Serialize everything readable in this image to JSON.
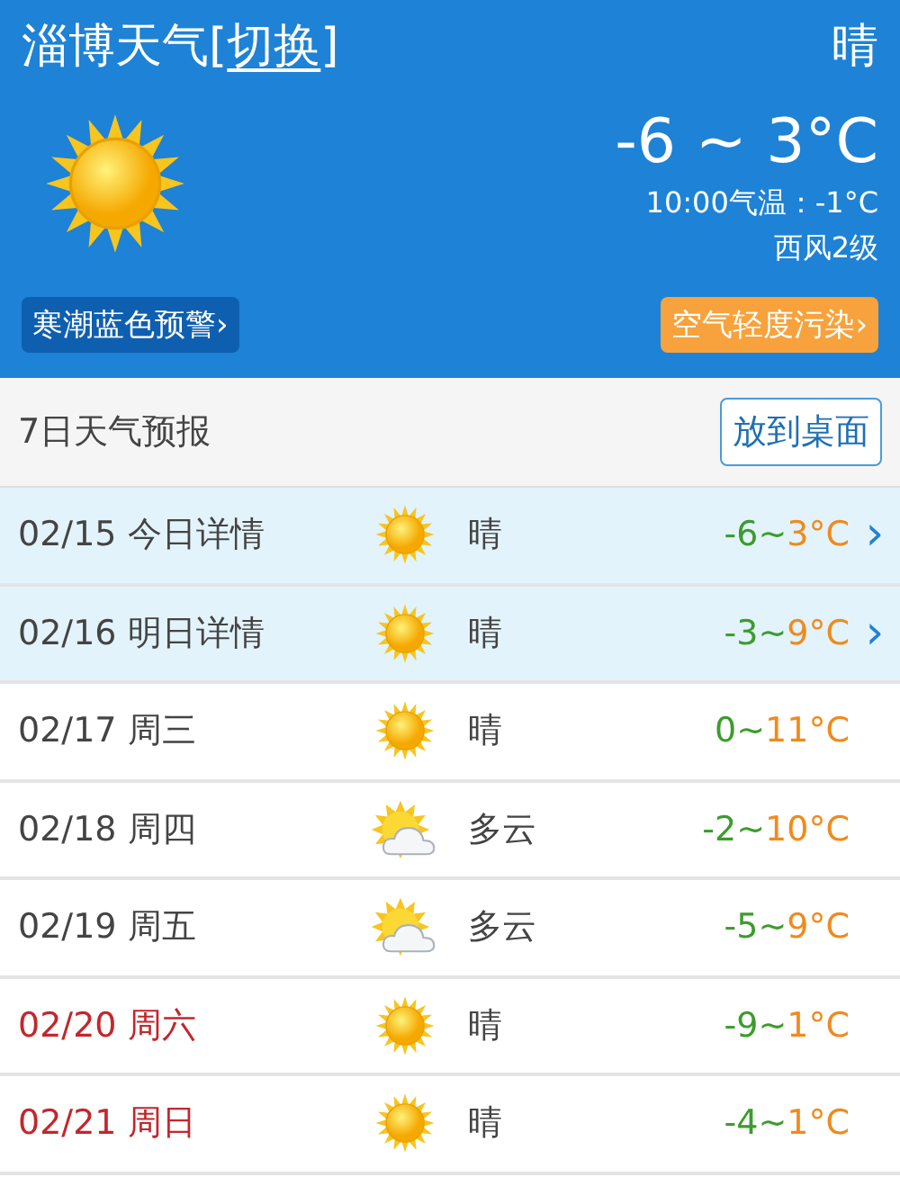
{
  "header": {
    "city": "淄博天气",
    "bracket_open": "[",
    "switch_link": "切换",
    "bracket_close": "]",
    "condition": "晴",
    "kind": "sunny",
    "temp_range": "-6 ~ 3°C",
    "current_temp": "10:00气温：-1°C",
    "wind": "西风2级",
    "alert": "寒潮蓝色预警",
    "air_quality": "空气轻度污染",
    "chevron": "›"
  },
  "forecast": {
    "title": "7日天气预报",
    "button": "放到桌面",
    "rows": [
      {
        "date": "02/15",
        "day": "今日详情",
        "kind": "sunny",
        "condition": "晴",
        "low": "-6~",
        "high": "3°C",
        "highlighted": true,
        "weekend": false,
        "arrow": "›"
      },
      {
        "date": "02/16",
        "day": "明日详情",
        "kind": "sunny",
        "condition": "晴",
        "low": "-3~",
        "high": "9°C",
        "highlighted": true,
        "weekend": false,
        "arrow": "›"
      },
      {
        "date": "02/17",
        "day": "周三",
        "kind": "sunny",
        "condition": "晴",
        "low": "0~",
        "high": "11°C",
        "highlighted": false,
        "weekend": false
      },
      {
        "date": "02/18",
        "day": "周四",
        "kind": "cloudy",
        "condition": "多云",
        "low": "-2~",
        "high": "10°C",
        "highlighted": false,
        "weekend": false
      },
      {
        "date": "02/19",
        "day": "周五",
        "kind": "cloudy",
        "condition": "多云",
        "low": "-5~",
        "high": "9°C",
        "highlighted": false,
        "weekend": false
      },
      {
        "date": "02/20",
        "day": "周六",
        "kind": "sunny",
        "condition": "晴",
        "low": "-9~",
        "high": "1°C",
        "highlighted": false,
        "weekend": true
      },
      {
        "date": "02/21",
        "day": "周日",
        "kind": "sunny",
        "condition": "晴",
        "low": "-4~",
        "high": "1°C",
        "highlighted": false,
        "weekend": true
      }
    ]
  }
}
